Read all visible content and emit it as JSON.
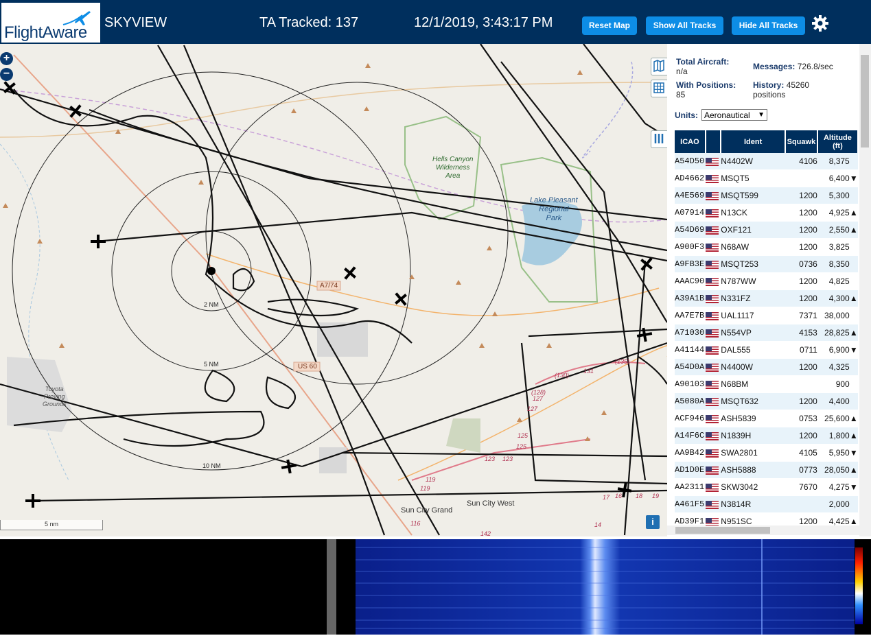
{
  "header": {
    "brand_flight": "Flight",
    "brand_aware": "Aware",
    "app_title": "SKYVIEW",
    "tracked": "TA Tracked: 137",
    "datetime": "12/1/2019, 3:43:17 PM",
    "reset_map": "Reset Map",
    "show_all": "Show All Tracks",
    "hide_all": "Hide All Tracks",
    "settings_icon": "gear-icon",
    "brand_color": "#002f5d",
    "button_color": "#0d8de6"
  },
  "map": {
    "zoom_in": "+",
    "zoom_out": "−",
    "scale": "5 nm",
    "info": "i",
    "ring_labels": [
      "2 NM",
      "5 NM",
      "10 NM"
    ],
    "places": {
      "hells_canyon": [
        "Hells Canyon",
        "Wilderness",
        "Area"
      ],
      "lake_pleasant": [
        "Lake Pleasant",
        "Regional",
        "Park"
      ],
      "toyota": [
        "Toyota",
        "Proving",
        "Grounds"
      ],
      "sun_city_grand": "Sun City Grand",
      "sun_city_west": "Sun City West"
    },
    "roads": [
      "A7/74",
      "US 60"
    ],
    "road_numbers": [
      "(130)",
      "131",
      "(135)",
      "(128)",
      "127",
      "127",
      "125",
      "125",
      "123",
      "123",
      "119",
      "119",
      "116",
      "142",
      "17",
      "16",
      "18",
      "19",
      "14"
    ]
  },
  "stats": {
    "total_aircraft_label": "Total Aircraft:",
    "total_aircraft_value": "n/a",
    "messages_label": "Messages:",
    "messages_value": "726.8/sec",
    "with_positions_label": "With Positions:",
    "with_positions_value": "85",
    "history_label": "History:",
    "history_value": "45260",
    "history_unit": "positions",
    "units_label": "Units:",
    "units_value": "Aeronautical"
  },
  "table": {
    "headers": {
      "icao": "ICAO",
      "ident": "Ident",
      "squawk": "Squawk",
      "altitude": "Altitude",
      "altitude_unit": "(ft)"
    },
    "rows": [
      {
        "icao": "A54D50",
        "ident": "N4402W",
        "squawk": "4106",
        "alt": "8,375",
        "trend": ""
      },
      {
        "icao": "AD4662",
        "ident": "MSQT5",
        "squawk": "",
        "alt": "6,400",
        "trend": "▼"
      },
      {
        "icao": "A4E569",
        "ident": "MSQT599",
        "squawk": "1200",
        "alt": "5,300",
        "trend": ""
      },
      {
        "icao": "A07914",
        "ident": "N13CK",
        "squawk": "1200",
        "alt": "4,925",
        "trend": "▲"
      },
      {
        "icao": "A54D69",
        "ident": "OXF121",
        "squawk": "1200",
        "alt": "2,550",
        "trend": "▲"
      },
      {
        "icao": "A900F3",
        "ident": "N68AW",
        "squawk": "1200",
        "alt": "3,825",
        "trend": ""
      },
      {
        "icao": "A9FB3E",
        "ident": "MSQT253",
        "squawk": "0736",
        "alt": "8,350",
        "trend": ""
      },
      {
        "icao": "AAAC90",
        "ident": "N787WW",
        "squawk": "1200",
        "alt": "4,825",
        "trend": ""
      },
      {
        "icao": "A39A1B",
        "ident": "N331FZ",
        "squawk": "1200",
        "alt": "4,300",
        "trend": "▲"
      },
      {
        "icao": "AA7E7B",
        "ident": "UAL1117",
        "squawk": "7371",
        "alt": "38,000",
        "trend": ""
      },
      {
        "icao": "A71030",
        "ident": "N554VP",
        "squawk": "4153",
        "alt": "28,825",
        "trend": "▲"
      },
      {
        "icao": "A41144",
        "ident": "DAL555",
        "squawk": "0711",
        "alt": "6,900",
        "trend": "▼"
      },
      {
        "icao": "A54D0A",
        "ident": "N4400W",
        "squawk": "1200",
        "alt": "4,325",
        "trend": ""
      },
      {
        "icao": "A90103",
        "ident": "N68BM",
        "squawk": "",
        "alt": "900",
        "trend": ""
      },
      {
        "icao": "A5080A",
        "ident": "MSQT632",
        "squawk": "1200",
        "alt": "4,400",
        "trend": ""
      },
      {
        "icao": "ACF946",
        "ident": "ASH5839",
        "squawk": "0753",
        "alt": "25,600",
        "trend": "▲"
      },
      {
        "icao": "A14F6C",
        "ident": "N1839H",
        "squawk": "1200",
        "alt": "1,800",
        "trend": "▲"
      },
      {
        "icao": "AA9B42",
        "ident": "SWA2801",
        "squawk": "4105",
        "alt": "5,950",
        "trend": "▼"
      },
      {
        "icao": "AD1D0E",
        "ident": "ASH5888",
        "squawk": "0773",
        "alt": "28,050",
        "trend": "▲"
      },
      {
        "icao": "AA2311",
        "ident": "SKW3042",
        "squawk": "7670",
        "alt": "4,275",
        "trend": "▼"
      },
      {
        "icao": "A461F5",
        "ident": "N3814R",
        "squawk": "",
        "alt": "2,000",
        "trend": ""
      },
      {
        "icao": "AD39F1",
        "ident": "N951SC",
        "squawk": "1200",
        "alt": "4,425",
        "trend": "▲"
      }
    ]
  }
}
